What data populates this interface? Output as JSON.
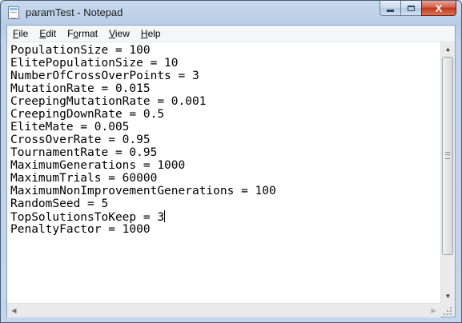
{
  "window": {
    "title": "paramTest - Notepad",
    "close_glyph": "X"
  },
  "menubar": [
    {
      "accel": "F",
      "rest": "ile"
    },
    {
      "accel": "E",
      "rest": "dit"
    },
    {
      "pre": "F",
      "accel": "o",
      "rest": "rmat"
    },
    {
      "accel": "V",
      "rest": "iew"
    },
    {
      "accel": "H",
      "rest": "elp"
    }
  ],
  "editor": {
    "lines": [
      "PopulationSize = 100",
      "ElitePopulationSize = 10",
      "NumberOfCrossOverPoints = 3",
      "MutationRate = 0.015",
      "CreepingMutationRate = 0.001",
      "CreepingDownRate = 0.5",
      "EliteMate = 0.005",
      "CrossOverRate = 0.95",
      "TournamentRate = 0.95",
      "MaximumGenerations = 1000",
      "MaximumTrials = 60000",
      "MaximumNonImprovementGenerations = 100",
      "RandomSeed = 5",
      "TopSolutionsToKeep = 3",
      "PenaltyFactor = 1000"
    ],
    "caret_line": 13
  },
  "colors": {
    "title_text": "#1c1c1c",
    "close_button": "#c2361c",
    "editor_bg": "#ffffff"
  }
}
